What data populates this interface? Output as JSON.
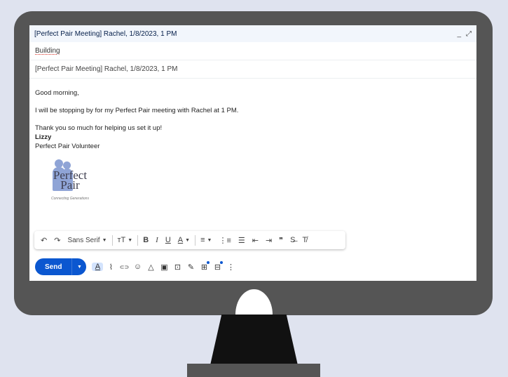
{
  "window": {
    "title": "[Perfect Pair Meeting] Rachel, 1/8/2023, 1 PM",
    "minimize_icon": "minimize-icon",
    "expand_icon": "expand-icon"
  },
  "recipients": {
    "to": "Building"
  },
  "subject": "[Perfect Pair Meeting] Rachel, 1/8/2023, 1 PM",
  "body": {
    "greeting": "Good morning,",
    "line1": "I will be stopping by for my Perfect Pair meeting with Rachel at 1 PM.",
    "line2": "Thank you so much for helping us set it up!",
    "signature_name": "Lizzy",
    "signature_title": "Perfect Pair Volunteer"
  },
  "logo": {
    "line1": "Perfect",
    "line2": "Pair",
    "tagline": "Connecting Generations"
  },
  "format_toolbar": {
    "undo": "↶",
    "redo": "↷",
    "font": "Sans Serif",
    "size": "тT",
    "bold": "B",
    "italic": "I",
    "underline": "U",
    "text_color": "A",
    "align": "≡",
    "numbered_list": "⋮≡",
    "bulleted_list": "☰",
    "indent_less": "⇤",
    "indent_more": "⇥",
    "quote": "❞",
    "strikethrough": "S̶",
    "clear_formatting": "T̸"
  },
  "send": {
    "label": "Send"
  },
  "bottom_toolbar": {
    "format": "A",
    "attach": "⌇",
    "link": "⊂⊃",
    "emoji": "☺",
    "drive": "△",
    "photo": "▣",
    "confidential": "⊡",
    "signature": "✎",
    "layouts": "⊞",
    "schedule": "⊟",
    "more": "⋮"
  },
  "colors": {
    "accent": "#0b57d0",
    "background": "#dfe3ef",
    "monitor": "#555555"
  }
}
